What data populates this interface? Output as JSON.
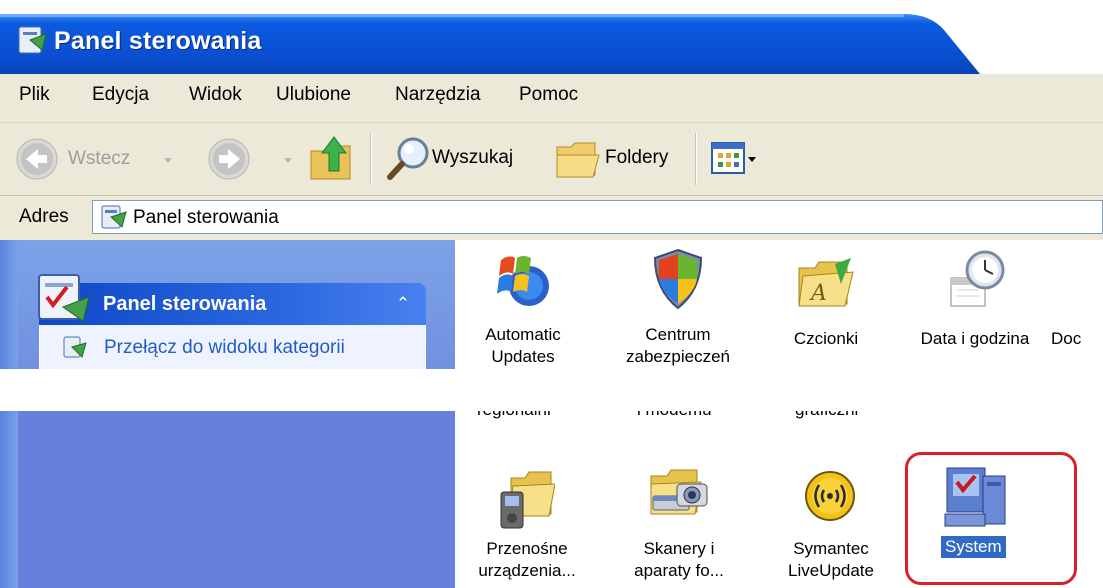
{
  "window": {
    "title": "Panel sterowania",
    "colors": {
      "titlebar": "#0a53d9",
      "menu_bg": "#ece9d8",
      "left_pane": "#6d8ee0",
      "selection": "#316ac5",
      "highlight_ring": "#d7222a"
    }
  },
  "menu": [
    "Plik",
    "Edycja",
    "Widok",
    "Ulubione",
    "Narzędzia",
    "Pomoc"
  ],
  "toolbar": {
    "back_label": "Wstecz",
    "search_label": "Wyszukaj",
    "folders_label": "Foldery"
  },
  "address": {
    "label": "Adres",
    "value": "Panel sterowania"
  },
  "left_pane": {
    "panel_title": "Panel sterowania",
    "switch_link": "Przełącz do widoku kategorii"
  },
  "icons_top": [
    {
      "line1": "Automatic",
      "line2": "Updates",
      "icon": "windows-update-icon"
    },
    {
      "line1": "Centrum",
      "line2": "zabezpieczeń",
      "icon": "security-center-shield-icon"
    },
    {
      "line1": "Czcionki",
      "line2": "",
      "icon": "fonts-folder-icon"
    },
    {
      "line1": "Data i godzina",
      "line2": "",
      "icon": "date-time-icon"
    },
    {
      "line1": "Doc",
      "line2": "",
      "icon": "partial-icon"
    }
  ],
  "icons_bottom": [
    {
      "line1": "Przenośne",
      "line2": "urządzenia...",
      "icon": "portable-devices-icon"
    },
    {
      "line1": "Skanery i",
      "line2": "aparaty fo...",
      "icon": "scanner-camera-icon"
    },
    {
      "line1": "Symantec",
      "line2": "LiveUpdate",
      "icon": "symantec-liveupdate-icon"
    },
    {
      "line1": "System",
      "line2": "",
      "icon": "system-icon",
      "selected": true
    }
  ]
}
